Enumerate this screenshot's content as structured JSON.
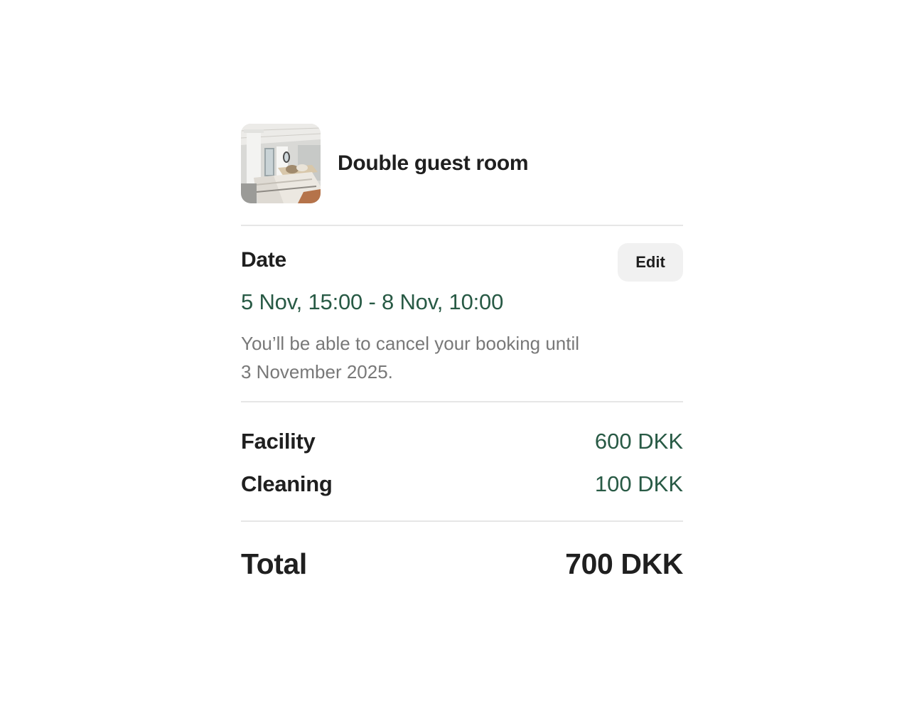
{
  "room": {
    "name": "Double guest room",
    "image_icon": "bedroom-photo"
  },
  "date": {
    "label": "Date",
    "edit_label": "Edit",
    "range": "5 Nov, 15:00 - 8 Nov, 10:00",
    "cancellation_note": "You’ll be able to cancel your booking until 3 November 2025."
  },
  "prices": {
    "items": [
      {
        "label": "Facility",
        "value": "600 DKK"
      },
      {
        "label": "Cleaning",
        "value": "100 DKK"
      }
    ],
    "total_label": "Total",
    "total_value": "700 DKK"
  },
  "colors": {
    "accent_green": "#285a45",
    "muted_text": "#787878",
    "button_bg": "#f1f1f1"
  }
}
